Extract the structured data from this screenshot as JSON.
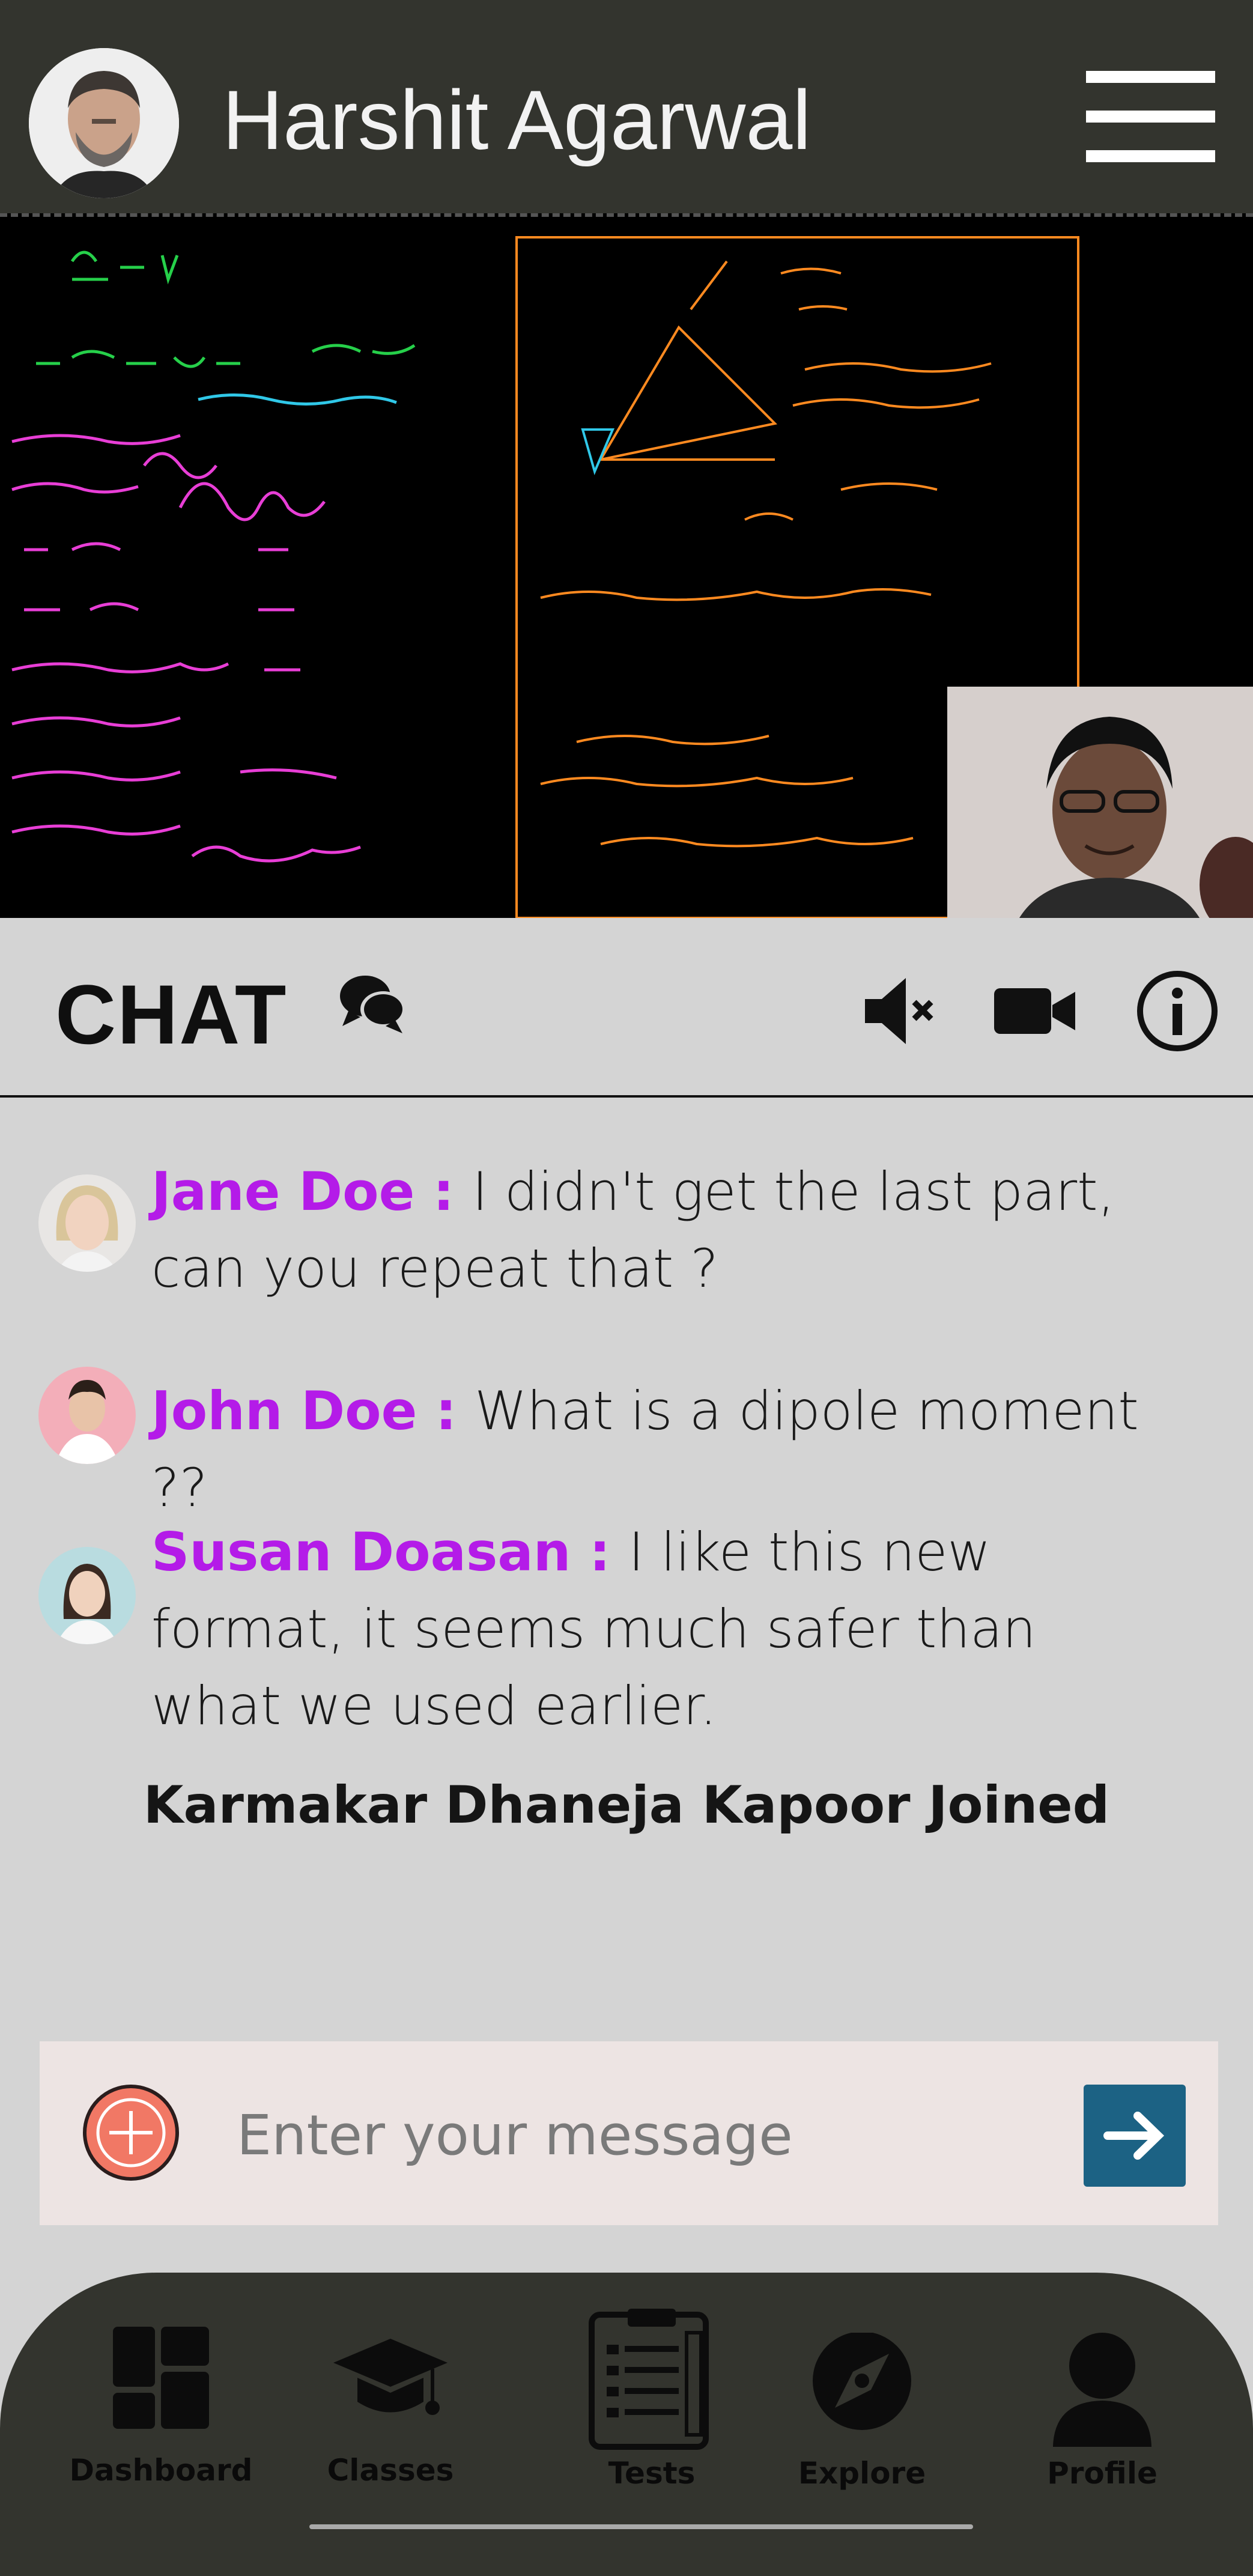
{
  "header": {
    "title": "Harshit Agarwal",
    "avatar_icon": "profile-photo",
    "menu_icon": "hamburger-menu-icon"
  },
  "video": {
    "main_feed": "whiteboard-physics-notes",
    "pip_feed": "self-camera"
  },
  "chat": {
    "title": "CHAT",
    "chat_icon": "chat-bubbles-icon",
    "mute_icon": "speaker-muted-icon",
    "camera_icon": "video-camera-icon",
    "info_icon": "info-icon",
    "messages": [
      {
        "name": "Jane Doe :",
        "text": "I didn't get the last part, can you repeat that ?"
      },
      {
        "name": "John Doe :",
        "text": "What is a dipole moment ??"
      },
      {
        "name": "Susan Doasan :",
        "text": "I like this new format, it seems much safer than what we used earlier."
      }
    ],
    "system_message": "Karmakar Dhaneja Kapoor Joined"
  },
  "composer": {
    "placeholder": "Enter your message",
    "add_icon": "plus-icon",
    "send_icon": "arrow-right-icon"
  },
  "nav": {
    "items": [
      {
        "label": "Dashboard",
        "icon": "dashboard-icon"
      },
      {
        "label": "Classes",
        "icon": "graduation-cap-icon"
      },
      {
        "label": "Tests",
        "icon": "test-checklist-icon"
      },
      {
        "label": "Explore",
        "icon": "compass-icon"
      },
      {
        "label": "Profile",
        "icon": "person-icon"
      }
    ]
  },
  "colors": {
    "bar": "#33342e",
    "background": "#d4d4d4",
    "accent_name": "#b41be8",
    "send": "#1c6284",
    "add": "#f17865"
  }
}
